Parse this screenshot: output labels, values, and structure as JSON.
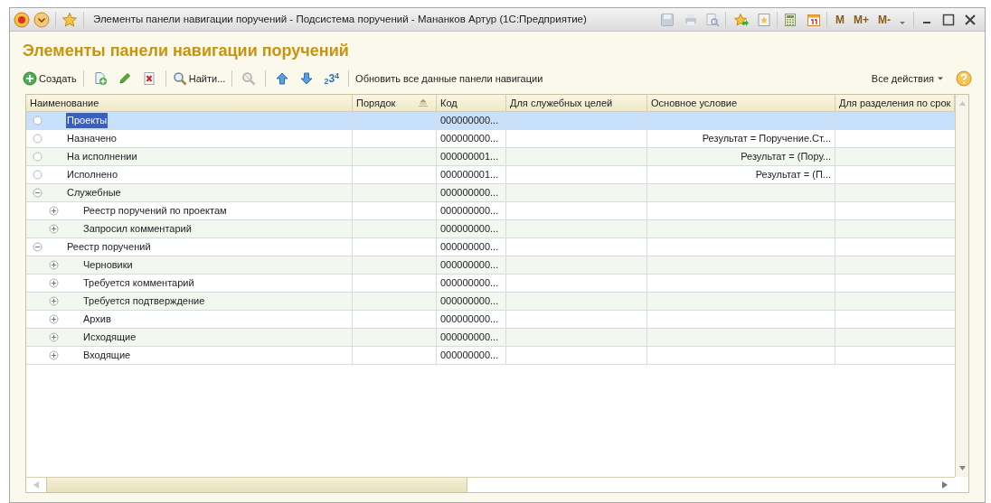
{
  "window": {
    "title": "Элементы панели навигации поручений - Подсистема поручений - Мананков Артур  (1С:Предприятие)",
    "memory_buttons": [
      "M",
      "M+",
      "M-"
    ]
  },
  "heading": "Элементы панели навигации поручений",
  "toolbar": [
    {
      "kind": "create",
      "label": "Создать"
    },
    {
      "kind": "copy"
    },
    {
      "kind": "edit"
    },
    {
      "kind": "delete"
    },
    {
      "kind": "find",
      "label": "Найти..."
    },
    {
      "kind": "cancel-find"
    },
    {
      "kind": "up"
    },
    {
      "kind": "down"
    },
    {
      "kind": "order",
      "label": "$_{2}$3$^{4}$"
    },
    {
      "kind": "text",
      "label": "Обновить все данные панели навигации"
    }
  ],
  "all_actions": "Все действия",
  "table": {
    "columns": [
      "Наименование",
      "Порядок",
      "Код",
      "Для служебных целей",
      "Основное условие",
      "Для разделения по срок"
    ],
    "rows": [
      {
        "kind": "item",
        "name": "Проекты",
        "code": "000000000...",
        "selected": true
      },
      {
        "kind": "item",
        "name": "Назначено",
        "code": "000000000...",
        "condition": "Результат = Поручение.Ст...",
        "selected": false
      },
      {
        "kind": "item",
        "name": "На исполнении",
        "code": "000000001...",
        "condition": "Результат = (Пору...",
        "selected": false
      },
      {
        "kind": "item",
        "name": "Исполнено",
        "code": "000000001...",
        "condition": "Результат = (П...",
        "selected": false
      },
      {
        "kind": "group",
        "name": "Служебные",
        "code": "000000000...",
        "selected": false,
        "expanded": true,
        "children": [
          {
            "kind": "group",
            "name": "Реестр поручений по проектам",
            "code": "000000000...",
            "selected": false,
            "expanded": false
          },
          {
            "kind": "group",
            "name": "Запросил комментарий",
            "code": "000000000...",
            "selected": false,
            "expanded": false
          }
        ]
      },
      {
        "kind": "group",
        "name": "Реестр поручений",
        "code": "000000000...",
        "selected": false,
        "expanded": true,
        "children": [
          {
            "kind": "group",
            "name": "Черновики",
            "code": "000000000...",
            "selected": false,
            "expanded": false
          },
          {
            "kind": "group",
            "name": "Требуется комментарий",
            "code": "000000000...",
            "selected": false,
            "expanded": false
          },
          {
            "kind": "group",
            "name": "Требуется подтверждение",
            "code": "000000000...",
            "selected": false,
            "expanded": false
          },
          {
            "kind": "group",
            "name": "Архив",
            "code": "000000000...",
            "selected": false,
            "expanded": false
          },
          {
            "kind": "group",
            "name": "Исходящие",
            "code": "000000000...",
            "selected": false,
            "expanded": false
          },
          {
            "kind": "group",
            "name": "Входящие",
            "code": "000000000...",
            "selected": false,
            "expanded": false
          }
        ]
      }
    ]
  }
}
